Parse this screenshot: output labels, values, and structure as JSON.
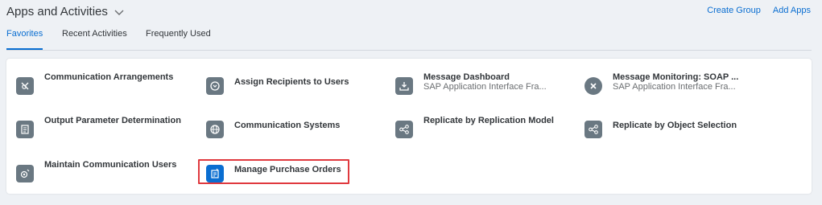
{
  "header": {
    "title": "Apps and Activities",
    "links": [
      "Create Group",
      "Add Apps"
    ]
  },
  "tabs": [
    "Favorites",
    "Recent Activities",
    "Frequently Used"
  ],
  "active_tab": "Favorites",
  "tiles": [
    {
      "title": "Communication Arrangements",
      "subtitle": "",
      "icon": "communication-arrangements-icon"
    },
    {
      "title": "Assign Recipients to Users",
      "subtitle": "",
      "icon": "assign-recipients-icon"
    },
    {
      "title": "Message Dashboard",
      "subtitle": "SAP Application Interface Fra...",
      "icon": "message-dashboard-icon"
    },
    {
      "title": "Message Monitoring: SOAP ...",
      "subtitle": "SAP Application Interface Fra...",
      "icon": "error-x-icon"
    },
    {
      "title": "Output Parameter Determination",
      "subtitle": "",
      "icon": "output-parameter-icon"
    },
    {
      "title": "Communication Systems",
      "subtitle": "",
      "icon": "globe-icon"
    },
    {
      "title": "Replicate by Replication Model",
      "subtitle": "",
      "icon": "share-icon"
    },
    {
      "title": "Replicate by Object Selection",
      "subtitle": "",
      "icon": "share-icon"
    },
    {
      "title": "Maintain Communication Users",
      "subtitle": "",
      "icon": "user-communication-icon"
    },
    {
      "title": "Manage Purchase Orders",
      "subtitle": "",
      "icon": "purchase-order-icon"
    }
  ],
  "colors": {
    "accent": "#0a6ed1",
    "icon_gray": "#6a7882",
    "highlight": "#e0393e",
    "background": "#eef1f5"
  }
}
